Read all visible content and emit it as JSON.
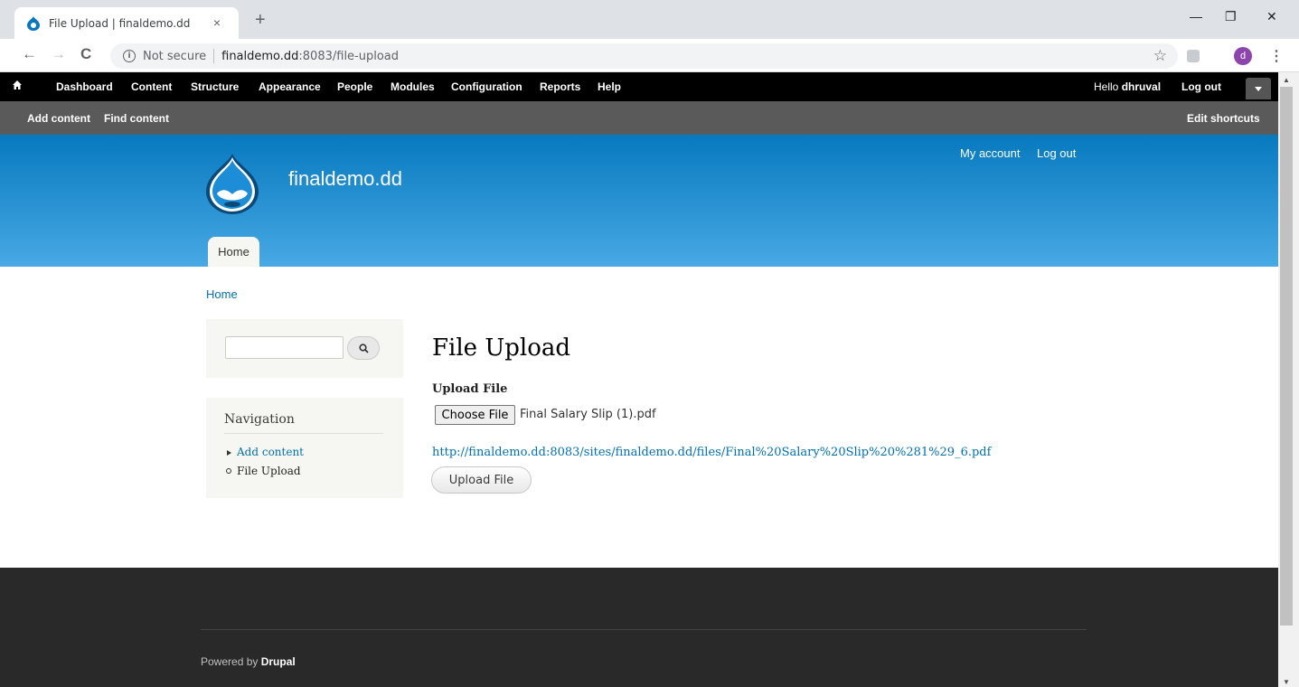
{
  "browser": {
    "tab_title": "File Upload | finaldemo.dd",
    "tab_close": "×",
    "new_tab": "+",
    "window_minimize": "—",
    "window_restore": "❐",
    "window_close": "✕",
    "back": "←",
    "forward": "→",
    "reload": "C",
    "not_secure": "Not secure",
    "url_host": "finaldemo.dd",
    "url_path": ":8083/file-upload",
    "profile_initial": "d"
  },
  "toolbar": {
    "items": [
      "Dashboard",
      "Content",
      "Structure",
      "Appearance",
      "People",
      "Modules",
      "Configuration",
      "Reports",
      "Help"
    ],
    "hello_prefix": "Hello",
    "username": "dhruval",
    "logout": "Log out"
  },
  "shortcuts": {
    "add_content": "Add content",
    "find_content": "Find content",
    "edit_shortcuts": "Edit shortcuts"
  },
  "header": {
    "site_name": "finaldemo.dd",
    "my_account": "My account",
    "logout": "Log out",
    "main_tab": "Home"
  },
  "breadcrumb": "Home",
  "sidebar": {
    "nav_title": "Navigation",
    "items": [
      "Add content",
      "File Upload"
    ]
  },
  "main": {
    "title": "File Upload",
    "field_label": "Upload File",
    "choose_file": "Choose File",
    "chosen_file": "Final Salary Slip (1).pdf",
    "file_link": "http://finaldemo.dd:8083/sites/finaldemo.dd/files/Final%20Salary%20Slip%20%281%29_6.pdf",
    "upload_button": "Upload File"
  },
  "footer": {
    "powered_prefix": "Powered by",
    "powered_brand": "Drupal"
  },
  "colors": {
    "header_top": "#0779bf",
    "header_bottom": "#48a9e4",
    "link": "#0071b3",
    "footer": "#292929"
  }
}
